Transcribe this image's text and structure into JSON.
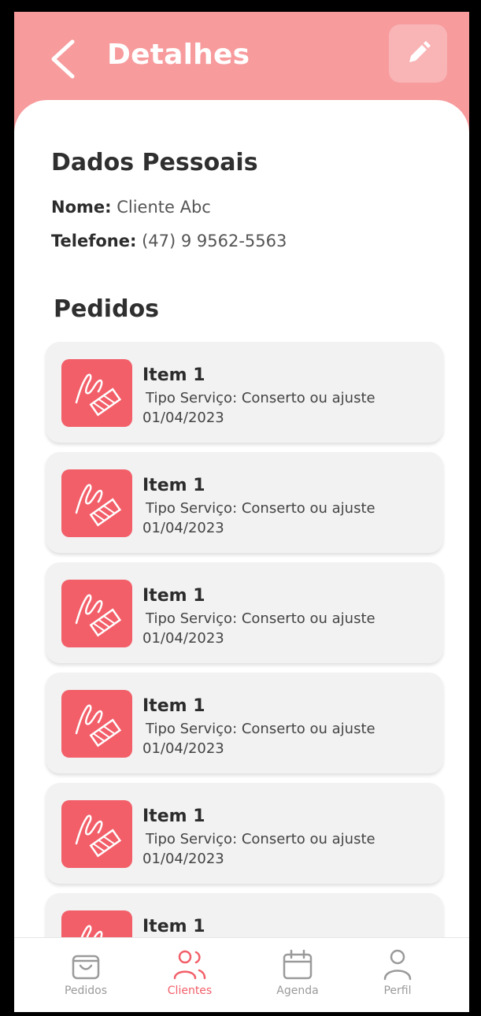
{
  "header": {
    "title": "Detalhes",
    "back_icon": "chevron-left-icon",
    "edit_icon": "pencil-icon"
  },
  "personal": {
    "section_title": "Dados Pessoais",
    "name_label": "Nome:",
    "name_value": "Cliente Abc",
    "phone_label": "Telefone:",
    "phone_value": "(47) 9 9562-5563"
  },
  "orders": {
    "section_title": "Pedidos",
    "items": [
      {
        "name": "Item 1",
        "type": "Tipo Serviço: Conserto ou ajuste",
        "date": "01/04/2023"
      },
      {
        "name": "Item 1",
        "type": "Tipo Serviço: Conserto ou ajuste",
        "date": "01/04/2023"
      },
      {
        "name": "Item 1",
        "type": "Tipo Serviço: Conserto ou ajuste",
        "date": "01/04/2023"
      },
      {
        "name": "Item 1",
        "type": "Tipo Serviço: Conserto ou ajuste",
        "date": "01/04/2023"
      },
      {
        "name": "Item 1",
        "type": "Tipo Serviço: Conserto ou ajuste",
        "date": "01/04/2023"
      },
      {
        "name": "Item 1",
        "type": "",
        "date": ""
      }
    ]
  },
  "nav": {
    "items": [
      {
        "label": "Pedidos",
        "icon": "shopping-bag-icon"
      },
      {
        "label": "Clientes",
        "icon": "users-icon",
        "active": true
      },
      {
        "label": "Agenda",
        "icon": "calendar-icon"
      },
      {
        "label": "Perfil",
        "icon": "user-icon"
      }
    ]
  },
  "colors": {
    "header": "#f79b9d",
    "accent": "#f25f69",
    "card": "#f2f2f2",
    "inactive": "#9a9a9a"
  }
}
